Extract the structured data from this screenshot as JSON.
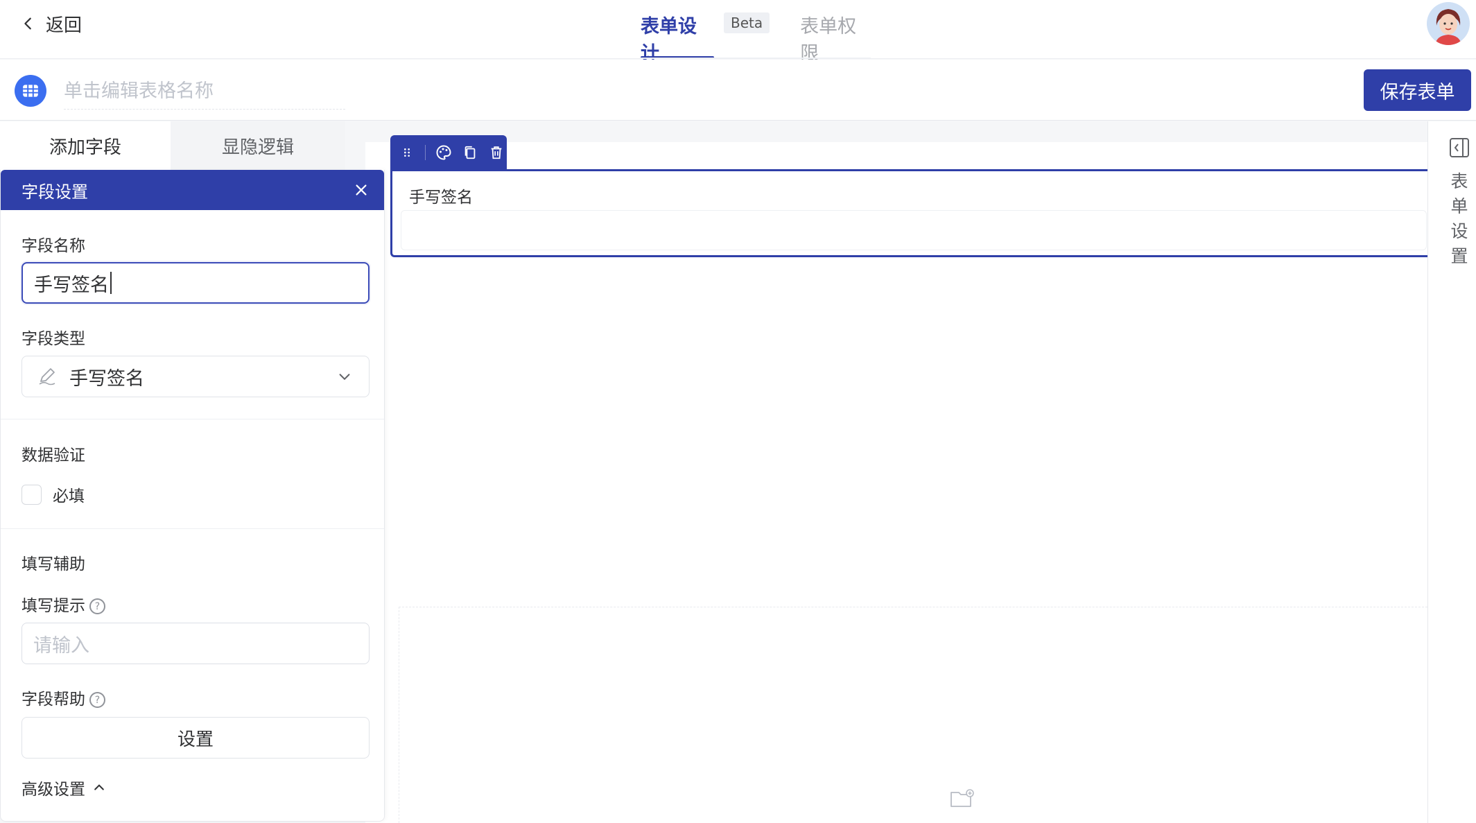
{
  "header": {
    "back_label": "返回",
    "tabs": [
      {
        "label": "表单设计",
        "active": true
      },
      {
        "label": "表单权限",
        "active": false
      }
    ],
    "beta_badge": "Beta"
  },
  "form_name": {
    "placeholder": "单击编辑表格名称",
    "value": ""
  },
  "toolbar": {
    "save_label": "保存表单"
  },
  "left_tabs": [
    {
      "label": "添加字段",
      "active": true
    },
    {
      "label": "显隐逻辑",
      "active": false
    }
  ],
  "field_settings": {
    "title": "字段设置",
    "name_label": "字段名称",
    "name_value": "手写签名",
    "type_label": "字段类型",
    "type_value": "手写签名",
    "validation_label": "数据验证",
    "required_label": "必填",
    "required_checked": false,
    "assist_label": "填写辅助",
    "hint_label": "填写提示",
    "hint_placeholder": "请输入",
    "help_label": "字段帮助",
    "help_button": "设置",
    "advanced_label": "高级设置"
  },
  "canvas": {
    "field_label": "手写签名"
  },
  "right_rail": {
    "label_chars": [
      "表",
      "单",
      "设",
      "置"
    ]
  },
  "icons": {
    "back": "chevron-left-icon",
    "table": "table-grid-icon",
    "close": "close-icon",
    "field_type": "pen-icon",
    "select_arrow": "chevron-down-icon",
    "help": "question-circle-icon",
    "advanced": "chevron-up-icon",
    "drag": "drag-handle-icon",
    "style": "palette-icon",
    "copy": "copy-icon",
    "delete": "trash-icon",
    "empty": "folder-add-icon",
    "collapse": "panel-collapse-icon"
  },
  "colors": {
    "primary": "#2f3fa8",
    "accent_blue": "#3b6ef0",
    "placeholder": "#c0c4cc"
  }
}
